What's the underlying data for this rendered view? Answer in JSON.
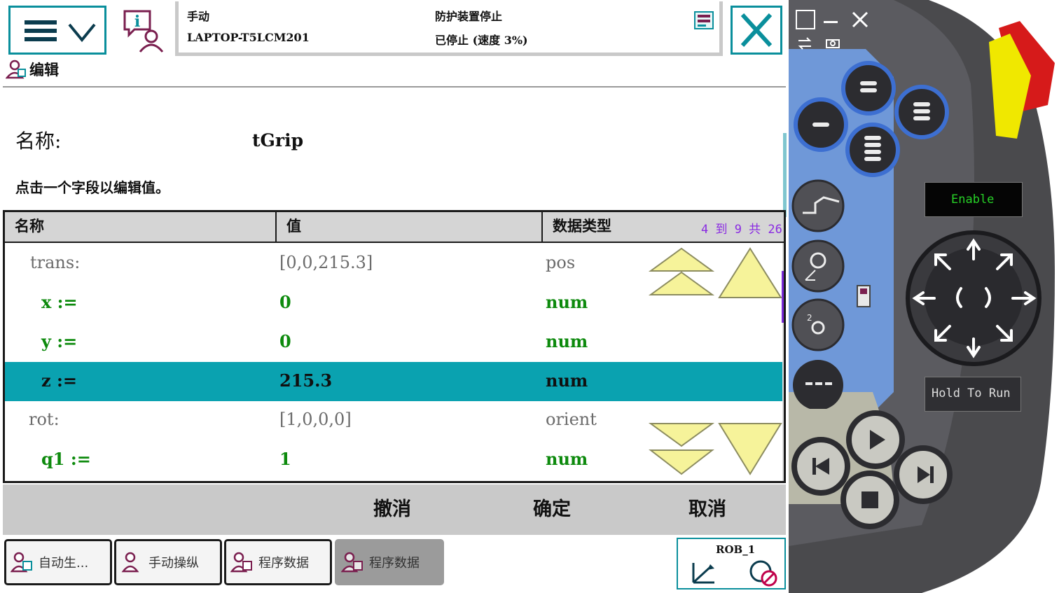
{
  "header": {
    "mode": "手动",
    "host": "LAPTOP-T5LCM201",
    "guard": "防护装置停止",
    "speed": "已停止 (速度 3%)"
  },
  "breadcrumb": {
    "label": "编辑"
  },
  "editor": {
    "name_label": "名称:",
    "name_value": "tGrip",
    "hint": "点击一个字段以编辑值。"
  },
  "table": {
    "columns": {
      "name": "名称",
      "value": "值",
      "type": "数据类型"
    },
    "page_info": "4 到 9 共 26",
    "rows": [
      {
        "name": "trans:",
        "value": "[0,0,215.3]",
        "type": "pos"
      },
      {
        "name": "x :=",
        "value": "0",
        "type": "num"
      },
      {
        "name": "y :=",
        "value": "0",
        "type": "num"
      },
      {
        "name": "z :=",
        "value": "215.3",
        "type": "num"
      },
      {
        "name": "rot:",
        "value": "[1,0,0,0]",
        "type": "orient"
      },
      {
        "name": "q1 :=",
        "value": "1",
        "type": "num"
      }
    ]
  },
  "commands": {
    "undo": "撤消",
    "ok": "确定",
    "cancel": "取消"
  },
  "taskbar": [
    {
      "label": "自动生..."
    },
    {
      "label": "手动操纵"
    },
    {
      "label": "程序数据"
    },
    {
      "label": "程序数据"
    }
  ],
  "quickset": {
    "label": "ROB_1"
  },
  "hardware": {
    "enable_label": "Enable",
    "hold_label": "Hold To Run"
  },
  "colors": {
    "accent": "#0a8f9c",
    "selected_row": "#0aa2b0",
    "field_text": "#0d8a0d",
    "nav_arrow": "#f6f39a",
    "scroll_thumb": "#7a2bd6"
  }
}
